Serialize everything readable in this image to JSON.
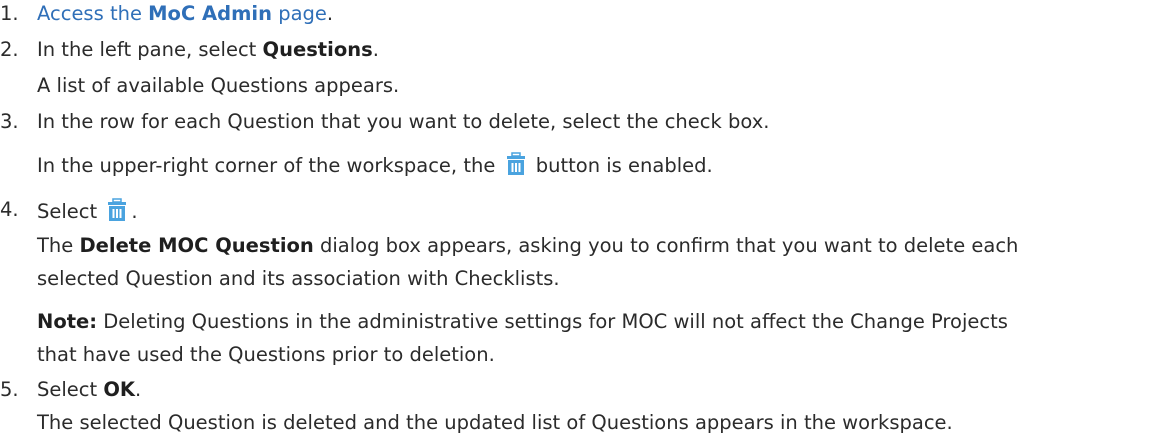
{
  "steps": [
    {
      "number": "1.",
      "link_prefix": "Access the ",
      "link_bold": "MoC Admin",
      "link_suffix": " page",
      "trailing": "."
    },
    {
      "number": "2.",
      "text_before": "In the left pane, select ",
      "bold": "Questions",
      "text_after": ".",
      "result": "A list of available Questions appears."
    },
    {
      "number": "3.",
      "text": "In the row for each Question that you want to delete, select the check box.",
      "result_before": "In the upper-right corner of the workspace, the ",
      "result_after": " button is enabled."
    },
    {
      "number": "4.",
      "text_before": "Select ",
      "text_after": ".",
      "result_bold": "Delete MOC Question",
      "result_line1": " dialog box appears, asking you to confirm that you want to delete each",
      "result_prefix": "The ",
      "result_line2": "selected Question and its association with Checklists.",
      "note_label": "Note:",
      "note_line1": " Deleting Questions in the administrative settings for MOC will not affect the Change Projects",
      "note_line2": "that have used the Questions prior to deletion."
    },
    {
      "number": "5.",
      "text_before": "Select ",
      "bold": "OK",
      "text_after": ".",
      "result": "The selected Question is deleted and the updated list of Questions appears in the workspace."
    }
  ],
  "icons": {
    "delete": "trash-icon",
    "color": "#4aa3df"
  }
}
